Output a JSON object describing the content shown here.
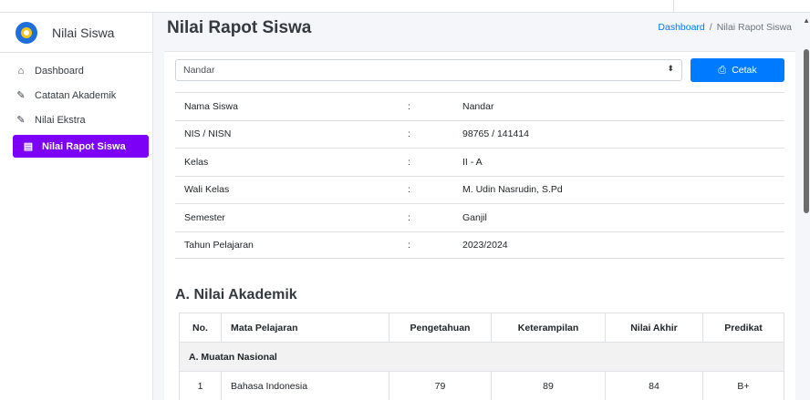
{
  "sidebar": {
    "brand": "Nilai Siswa",
    "items": [
      {
        "label": "Dashboard",
        "icon": "home-icon"
      },
      {
        "label": "Catatan Akademik",
        "icon": "edit-icon"
      },
      {
        "label": "Nilai Ekstra",
        "icon": "edit-icon"
      },
      {
        "label": "Nilai Rapot Siswa",
        "icon": "clipboard-icon",
        "active": true
      }
    ]
  },
  "header": {
    "title": "Nilai Rapot Siswa",
    "breadcrumb": {
      "home": "Dashboard",
      "separator": "/",
      "current": "Nilai Rapot Siswa"
    }
  },
  "student_select": {
    "value": "Nandar"
  },
  "print_button": {
    "label": "Cetak"
  },
  "student_info": [
    {
      "label": "Nama Siswa",
      "colon": ":",
      "value": "Nandar"
    },
    {
      "label": "NIS / NISN",
      "colon": ":",
      "value": "98765 / 141414"
    },
    {
      "label": "Kelas",
      "colon": ":",
      "value": "II - A"
    },
    {
      "label": "Wali Kelas",
      "colon": ":",
      "value": "M. Udin Nasrudin, S.Pd"
    },
    {
      "label": "Semester",
      "colon": ":",
      "value": "Ganjil"
    },
    {
      "label": "Tahun Pelajaran",
      "colon": ":",
      "value": "2023/2024"
    }
  ],
  "academic": {
    "title": "A. Nilai Akademik",
    "columns": [
      "No.",
      "Mata Pelajaran",
      "Pengetahuan",
      "Keterampilan",
      "Nilai Akhir",
      "Predikat"
    ],
    "group": "A. Muatan Nasional",
    "rows": [
      {
        "no": "1",
        "subject": "Bahasa Indonesia",
        "knowledge": "79",
        "skill": "89",
        "final": "84",
        "grade": "B+"
      }
    ]
  },
  "colors": {
    "accent": "#7c00f5",
    "primary": "#007bff"
  }
}
